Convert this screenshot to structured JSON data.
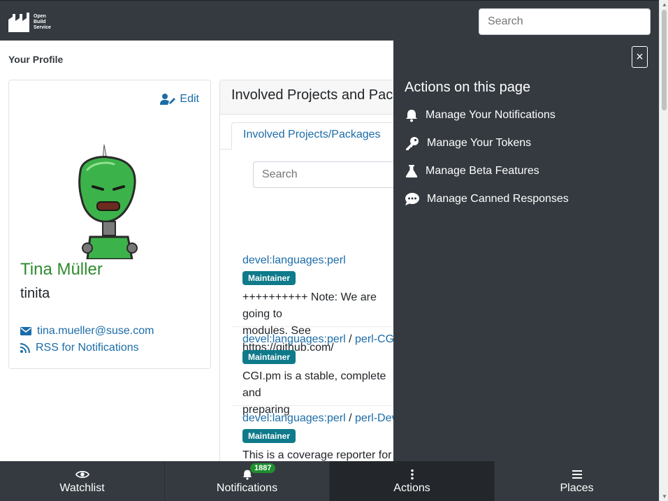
{
  "header": {
    "logo_lines": [
      "Open",
      "Build",
      "Service"
    ],
    "search_placeholder": "Search"
  },
  "breadcrumb": "Your Profile",
  "profile": {
    "edit_label": "Edit",
    "name": "Tina Müller",
    "login": "tinita",
    "email": "tina.mueller@suse.com",
    "rss_label": "RSS for Notifications"
  },
  "main": {
    "title": "Involved Projects and Packages",
    "tab_label": "Involved Projects/Packages",
    "search_placeholder": "Search",
    "items": [
      {
        "project": "devel:languages:perl",
        "package": "",
        "role": "Maintainer",
        "description_lines": [
          "++++++++++ Note: We are going to",
          "modules. See https://github.com/"
        ]
      },
      {
        "project": "devel:languages:perl",
        "package": "perl-CGI",
        "role": "Maintainer",
        "description_lines": [
          "CGI.pm is a stable, complete and",
          "preparing"
        ]
      },
      {
        "project": "devel:languages:perl",
        "package": "perl-Devel-Cover",
        "role": "Maintainer",
        "description_lines": [
          "This is a coverage reporter for"
        ]
      }
    ]
  },
  "actions_panel": {
    "close_symbol": "×",
    "title": "Actions on this page",
    "items": [
      {
        "label": "Manage Your Notifications",
        "icon": "bell-icon"
      },
      {
        "label": "Manage Your Tokens",
        "icon": "key-icon"
      },
      {
        "label": "Manage Beta Features",
        "icon": "flask-icon"
      },
      {
        "label": "Manage Canned Responses",
        "icon": "comment-dots-icon"
      }
    ]
  },
  "bottom_nav": {
    "watchlist": "Watchlist",
    "notifications": "Notifications",
    "notifications_count": "1887",
    "actions": "Actions",
    "places": "Places"
  },
  "colors": {
    "navbar": "#343a40",
    "link": "#1b6ca8",
    "profile_name": "#2e8b2e",
    "badge": "#0f7a8a",
    "count_badge": "#1f8f2f"
  }
}
